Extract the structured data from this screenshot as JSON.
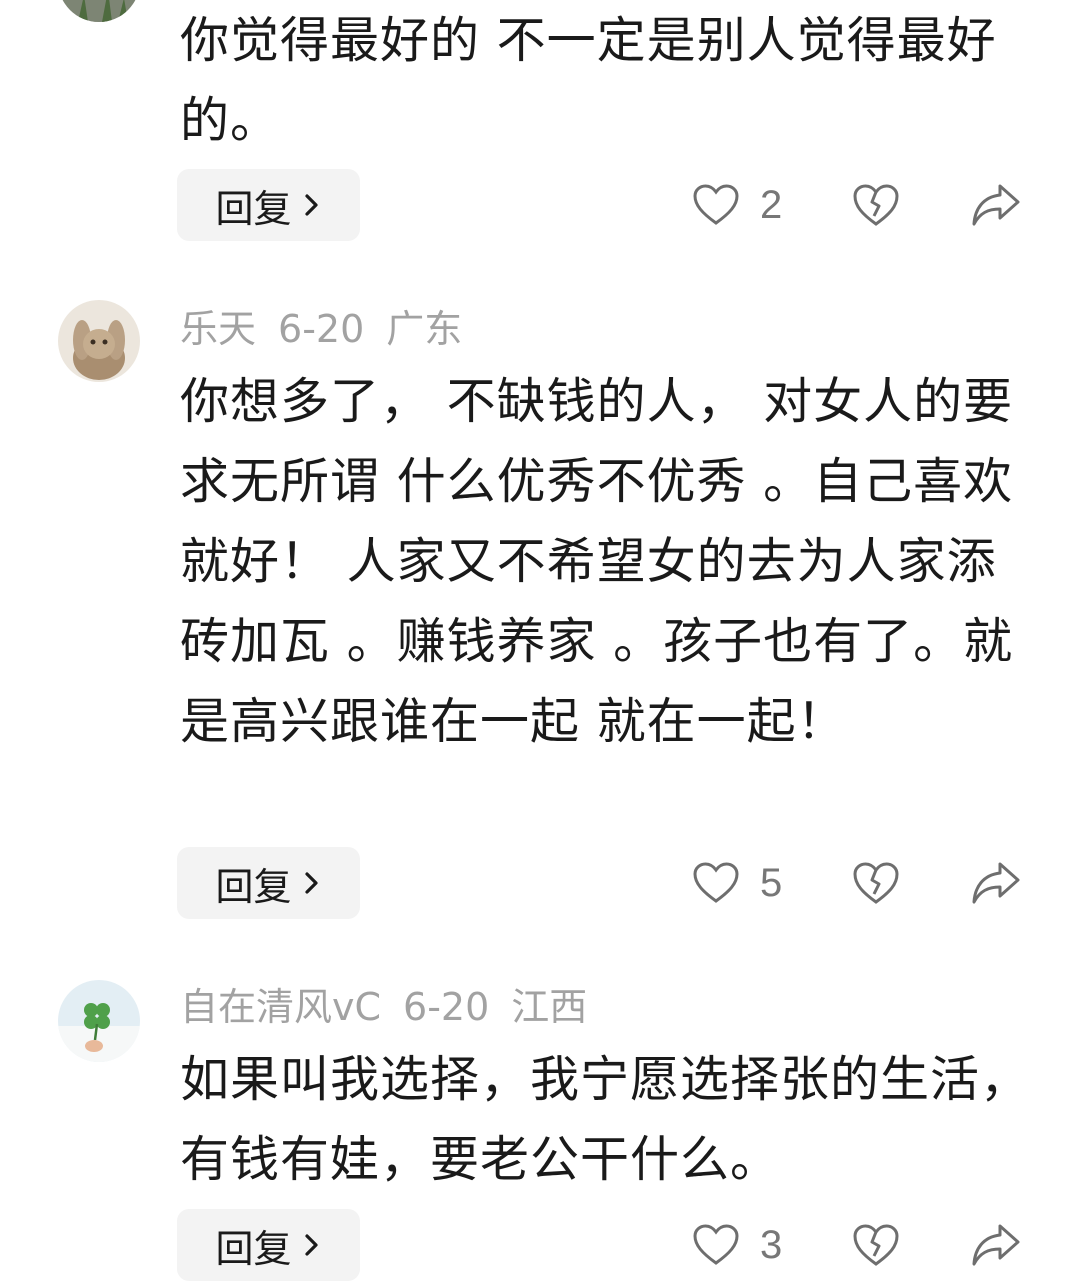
{
  "comments": [
    {
      "avatar": "plant-photo-avatar",
      "body": "你觉得最好的 不一定是别人觉得最好的。",
      "reply_label": "回复",
      "like_count": "2"
    },
    {
      "avatar": "rabbit-photo-avatar",
      "username": "乐天",
      "date": "6-20",
      "location": "广东",
      "body": "你想多了，  不缺钱的人，  对女人的要求无所谓 什么优秀不优秀 。自己喜欢就好！ 人家又不希望女的去为人家添砖加瓦 。赚钱养家 。孩子也有了。就是高兴跟谁在一起 就在一起！",
      "reply_label": "回复",
      "like_count": "5"
    },
    {
      "avatar": "clover-photo-avatar",
      "username": "自在清风vC",
      "date": "6-20",
      "location": "江西",
      "body": "如果叫我选择，我宁愿选择张的生活，有钱有娃，要老公干什么。",
      "reply_label": "回复",
      "like_count": "3"
    }
  ],
  "icons": {
    "like": "heart-outline-icon",
    "dislike": "broken-heart-icon",
    "share": "share-arrow-icon",
    "reply_chevron": "chevron-right-icon"
  },
  "colors": {
    "meta_text": "#a2a2a2",
    "reply_bg": "#f3f3f3",
    "icon_gray": "#6e6e6e"
  }
}
